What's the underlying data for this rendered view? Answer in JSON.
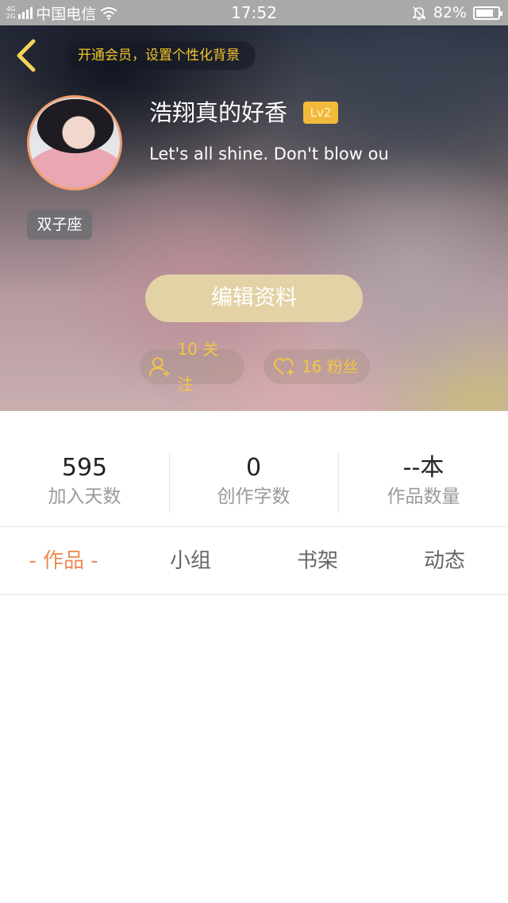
{
  "status_bar": {
    "network_top": "4G",
    "network_bottom": "2G",
    "carrier": "中国电信",
    "time": "17:52",
    "battery": "82%",
    "battery_level": 0.82
  },
  "header": {
    "vip_banner": "开通会员，设置个性化背景",
    "username": "浩翔真的好香",
    "level": "Lv2",
    "bio": "Let's all shine. Don't blow ou",
    "zodiac": "双子座",
    "edit_button": "编辑资料",
    "following_label": "10 关注",
    "fans_label": "16 粉丝"
  },
  "stats": [
    {
      "value": "595",
      "label": "加入天数"
    },
    {
      "value": "0",
      "label": "创作字数"
    },
    {
      "value": "--本",
      "label": "作品数量"
    }
  ],
  "tabs": [
    {
      "label": "- 作品 -",
      "active": true
    },
    {
      "label": "小组",
      "active": false
    },
    {
      "label": "书架",
      "active": false
    },
    {
      "label": "动态",
      "active": false
    }
  ],
  "colors": {
    "accent": "#ee8a55",
    "gold": "#f3c544",
    "level_badge": "#f2b93b",
    "edit_button": "#e3d2a6"
  }
}
